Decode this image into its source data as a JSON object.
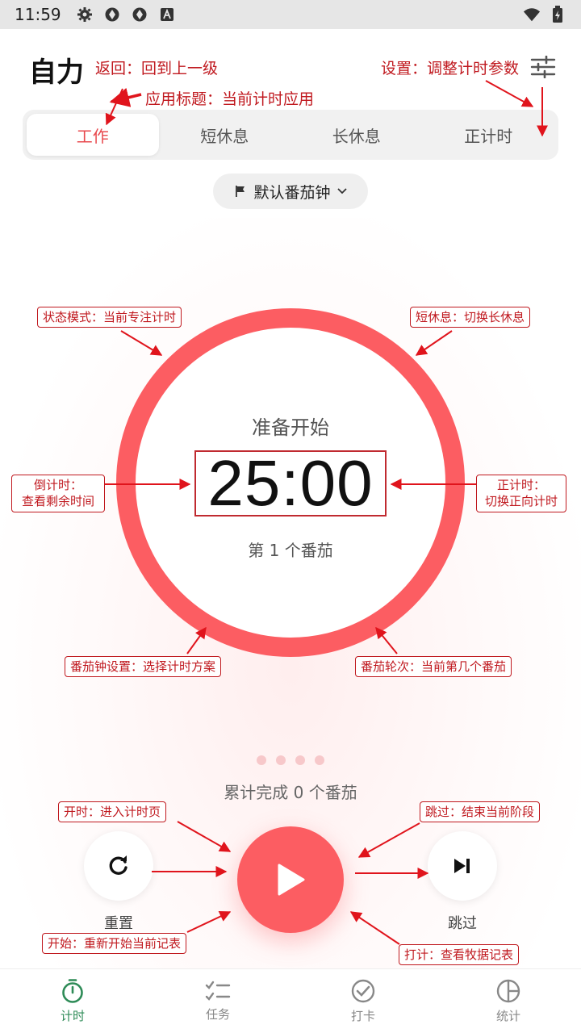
{
  "status_bar": {
    "time": "11:59",
    "icons": [
      "gear-icon",
      "sync-icon",
      "sync-icon",
      "a-icon"
    ],
    "right_icons": [
      "wifi-icon",
      "battery-icon"
    ]
  },
  "app": {
    "title": "自力"
  },
  "tabs": [
    {
      "label": "工作",
      "active": true
    },
    {
      "label": "短休息",
      "active": false
    },
    {
      "label": "长休息",
      "active": false
    },
    {
      "label": "正计时",
      "active": false
    }
  ],
  "preset": {
    "label": "默认番茄钟"
  },
  "timer": {
    "phase": "准备开始",
    "time": "25:00",
    "round": "第 1 个番茄"
  },
  "progress": {
    "dots": 4
  },
  "total": {
    "text": "累计完成 0 个番茄"
  },
  "controls": {
    "reset_label": "重置",
    "skip_label": "跳过"
  },
  "bottom_nav": [
    {
      "label": "计时",
      "icon": "stopwatch-icon",
      "active": true
    },
    {
      "label": "任务",
      "icon": "checklist-icon",
      "active": false
    },
    {
      "label": "打卡",
      "icon": "check-circle-icon",
      "active": false
    },
    {
      "label": "统计",
      "icon": "pie-chart-icon",
      "active": false
    }
  ],
  "annotations": {
    "back": "返回：回到上一级",
    "app_title": "应用标题：当前计时应用",
    "settings": "设置：调整计时参数",
    "status_mode": "状态模式：当前专注计时",
    "short_break": "短休息：切换长休息",
    "countdown_1": "倒计时：",
    "countdown_2": "查看剩余时间",
    "count_up_1": "正计时：",
    "count_up_2": "切换正向计时",
    "preset_setting": "番茄钟设置：选择计时方案",
    "round": "番茄轮次：当前第几个番茄",
    "start_timer": "开时：进入计时页",
    "skip": "跳过：结束当前阶段",
    "restart": "开始：重新开始当前记表",
    "checkin": "打计：查看牧据记表"
  },
  "colors": {
    "accent": "#fc5d62",
    "tab_active": "#e8494e",
    "nav_active": "#2e8b57",
    "annotation": "#c0191f"
  }
}
